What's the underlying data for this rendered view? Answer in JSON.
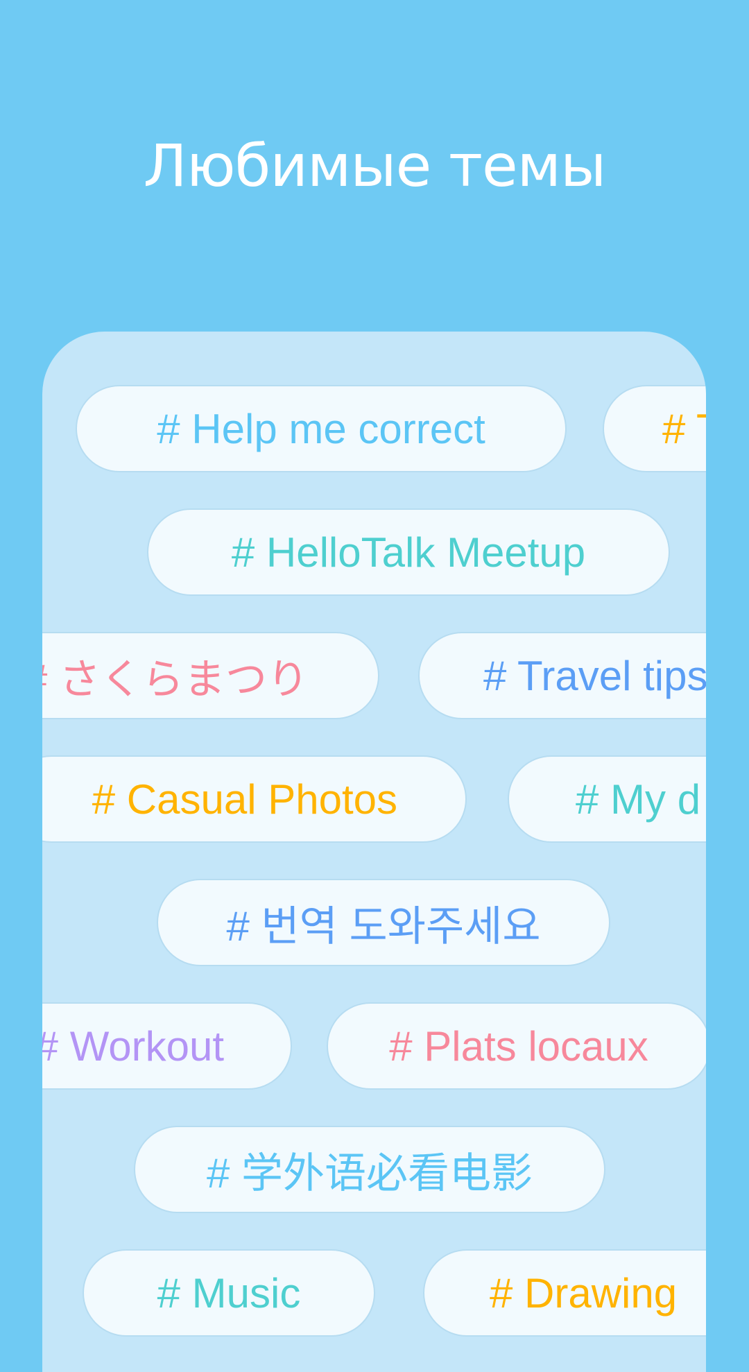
{
  "title": "Любимые темы",
  "colors": {
    "background": "#6fcaf3",
    "panel": "#c4e6f9",
    "chip": "#f2fafe",
    "light_blue": "#5bc5f5",
    "orange": "#ffb300",
    "teal": "#4ecfcf",
    "pink": "#f7889b",
    "blue": "#5b9ef5",
    "purple": "#b394f5"
  },
  "topics": [
    {
      "label": "# Help me correct",
      "color": "#5bc5f5"
    },
    {
      "label": "# T",
      "color": "#ffb300"
    },
    {
      "label": "# HelloTalk Meetup",
      "color": "#4ecfcf"
    },
    {
      "label": "# さくらまつり",
      "color": "#f7889b"
    },
    {
      "label": "# Travel tips",
      "color": "#5b9ef5"
    },
    {
      "label": "# Casual Photos",
      "color": "#ffb300"
    },
    {
      "label": "# My d",
      "color": "#4ecfcf"
    },
    {
      "label": "# 번역 도와주세요",
      "color": "#5b9ef5"
    },
    {
      "label": "# Workout",
      "color": "#b394f5"
    },
    {
      "label": "# Plats locaux",
      "color": "#f7889b"
    },
    {
      "label": "# 学外语必看电影",
      "color": "#5bc5f5"
    },
    {
      "label": "# Music",
      "color": "#4ecfcf"
    },
    {
      "label": "# Drawing",
      "color": "#ffb300"
    }
  ]
}
